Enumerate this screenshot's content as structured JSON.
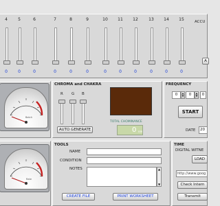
{
  "channels": [
    {
      "label": "4",
      "value": "0"
    },
    {
      "label": "5",
      "value": "0"
    },
    {
      "label": "6",
      "value": "0"
    },
    {
      "label": "7",
      "value": "0"
    },
    {
      "label": "8",
      "value": "0"
    },
    {
      "label": "9",
      "value": "0"
    },
    {
      "label": "10",
      "value": "0"
    },
    {
      "label": "11",
      "value": "0"
    },
    {
      "label": "12",
      "value": "0"
    },
    {
      "label": "13",
      "value": "0"
    },
    {
      "label": "14",
      "value": "0"
    },
    {
      "label": "15",
      "value": "0"
    }
  ],
  "accum_label": "ACCU",
  "right_button_label": "A",
  "gauge_top_caption": "Batch",
  "gauge_bottom_caption": "Rate",
  "chroma": {
    "title": "CHROMA and CHAKRA",
    "r_label": "R",
    "g_label": "G",
    "b_label": "B",
    "auto_generate_label": "AUTO GENERATE",
    "total_label": "TOTAL CHOMINANCE",
    "total_value": "0",
    "total_unit": "nm",
    "swatch_color": "#5a2a0a"
  },
  "frequency": {
    "title": "FREQUENCY",
    "values": [
      "0",
      "0",
      "0"
    ],
    "start_label": "START",
    "date_label": "DATE",
    "date_value": "20"
  },
  "tools": {
    "title": "TOOLS",
    "name_label": "NAME",
    "condition_label": "CONDITION",
    "notes_label": "NOTES",
    "create_file_label": "CREATE FILE",
    "print_label": "PRINT WORKSHEET"
  },
  "time": {
    "title": "TIME",
    "digital_label": "DIGITAL WITNE",
    "load_label": "LOAD",
    "url_value": "http://www.goog",
    "check_label": "Check Intern",
    "transmit_label": "Transmit"
  }
}
